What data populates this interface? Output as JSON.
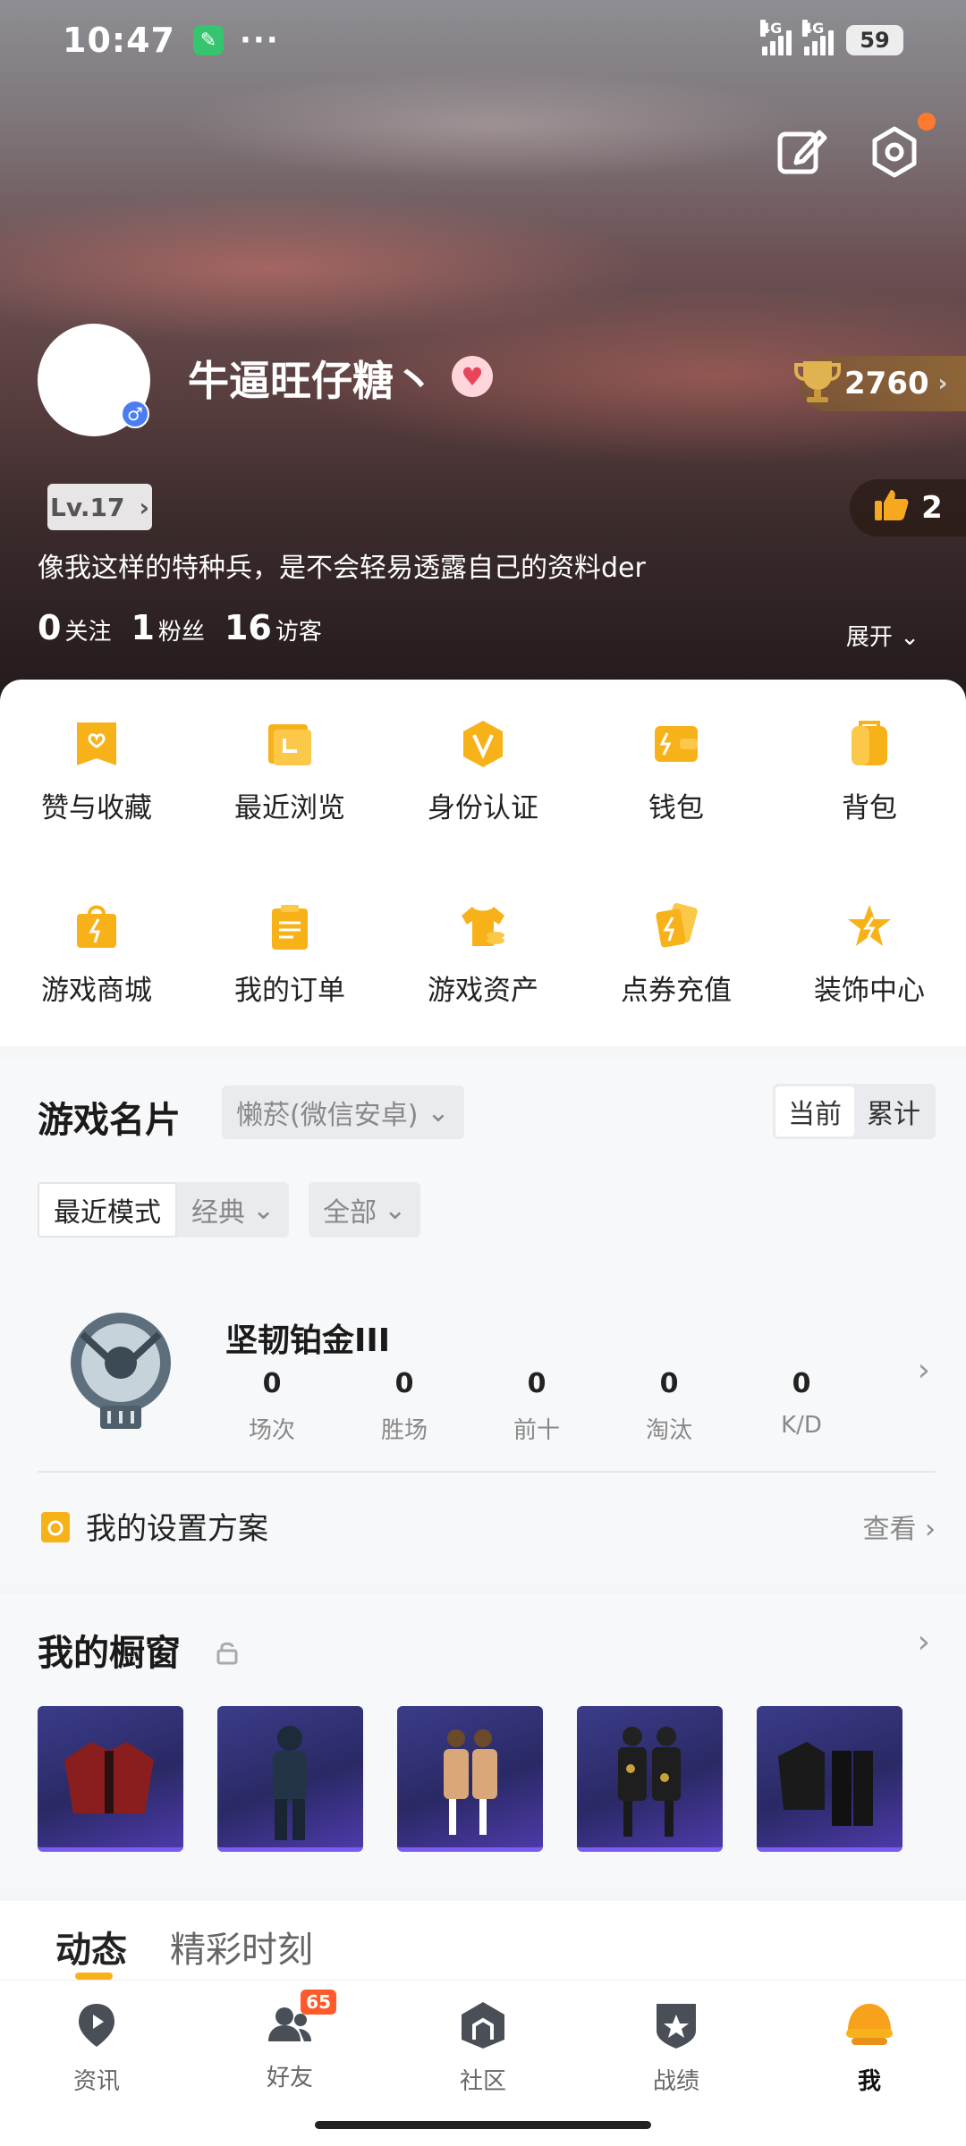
{
  "status_bar": {
    "time": "10:47",
    "dots": "···",
    "net1": "4G",
    "net2": "4G",
    "battery": "59"
  },
  "profile": {
    "username": "牛逼旺仔糖丶",
    "gender_symbol": "♂",
    "trophy_score": "2760",
    "level": "Lv.17",
    "likes": "2",
    "bio": "像我这样的特种兵，是不会轻易透露自己的资料der",
    "stats": [
      {
        "value": "0",
        "label": "关注"
      },
      {
        "value": "1",
        "label": "粉丝"
      },
      {
        "value": "16",
        "label": "访客"
      }
    ],
    "expand_label": "展开"
  },
  "quick_menu": [
    {
      "label": "赞与收藏",
      "icon": "bookmark-icon"
    },
    {
      "label": "最近浏览",
      "icon": "folder-icon"
    },
    {
      "label": "身份认证",
      "icon": "verify-badge-icon"
    },
    {
      "label": "钱包",
      "icon": "wallet-icon"
    },
    {
      "label": "背包",
      "icon": "backpack-icon"
    },
    {
      "label": "游戏商城",
      "icon": "shopping-bag-icon"
    },
    {
      "label": "我的订单",
      "icon": "clipboard-icon"
    },
    {
      "label": "游戏资产",
      "icon": "shirt-coins-icon"
    },
    {
      "label": "点券充值",
      "icon": "cards-icon"
    },
    {
      "label": "装饰中心",
      "icon": "star-icon"
    }
  ],
  "game_card": {
    "title": "游戏名片",
    "account": "懒菸(微信安卓)",
    "toggle": [
      "当前",
      "累计"
    ],
    "mode_label": "最近模式",
    "mode_value": "经典",
    "filter_value": "全部",
    "rank_name": "坚韧铂金III",
    "stats": [
      {
        "value": "0",
        "label": "场次"
      },
      {
        "value": "0",
        "label": "胜场"
      },
      {
        "value": "0",
        "label": "前十"
      },
      {
        "value": "0",
        "label": "淘汰"
      },
      {
        "value": "0",
        "label": "K/D"
      }
    ],
    "settings_label": "我的设置方案",
    "settings_action": "查看"
  },
  "showcase": {
    "title": "我的橱窗"
  },
  "feed_tabs": [
    "动态",
    "精彩时刻"
  ],
  "bottom_nav": [
    {
      "label": "资讯",
      "icon": "news-play-icon"
    },
    {
      "label": "好友",
      "icon": "friends-icon",
      "badge": "65"
    },
    {
      "label": "社区",
      "icon": "community-icon"
    },
    {
      "label": "战绩",
      "icon": "record-shield-icon"
    },
    {
      "label": "我",
      "icon": "helmet-icon",
      "active": true
    }
  ],
  "colors": {
    "accent": "#f7b21a",
    "badge": "#ff5a2b",
    "gender": "#4a7ef0"
  }
}
